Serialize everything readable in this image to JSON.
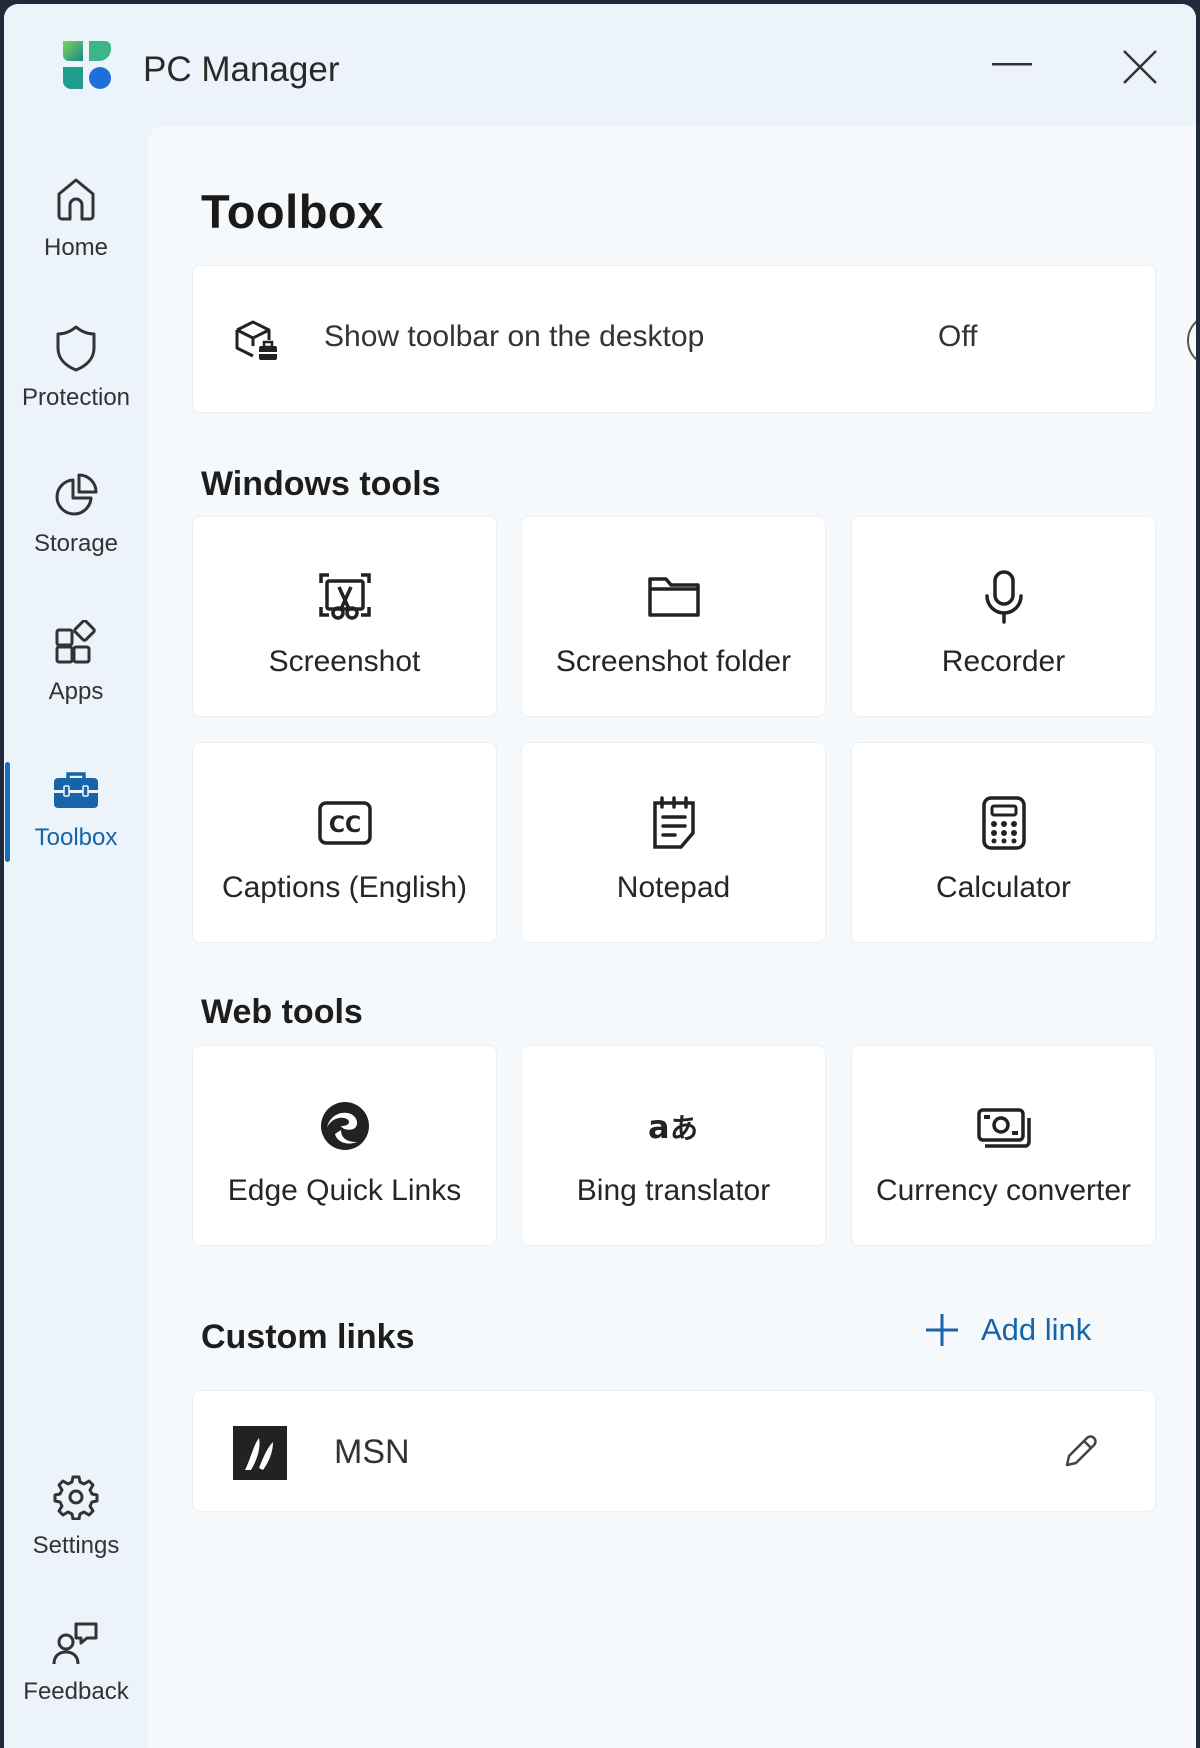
{
  "app": {
    "title": "PC Manager"
  },
  "sidebar": {
    "items": [
      {
        "label": "Home",
        "icon": "home-icon"
      },
      {
        "label": "Protection",
        "icon": "shield-icon"
      },
      {
        "label": "Storage",
        "icon": "pie-chart-icon"
      },
      {
        "label": "Apps",
        "icon": "apps-icon"
      },
      {
        "label": "Toolbox",
        "icon": "toolbox-icon",
        "active": true
      },
      {
        "label": "Settings",
        "icon": "gear-icon"
      },
      {
        "label": "Feedback",
        "icon": "feedback-icon"
      }
    ]
  },
  "page": {
    "title": "Toolbox"
  },
  "toolbar_setting": {
    "label": "Show toolbar on the desktop",
    "state": "Off",
    "enabled": false
  },
  "windows_tools": {
    "heading": "Windows tools",
    "items": [
      {
        "label": "Screenshot",
        "icon": "screenshot-icon"
      },
      {
        "label": "Screenshot folder",
        "icon": "folder-icon"
      },
      {
        "label": "Recorder",
        "icon": "microphone-icon"
      },
      {
        "label": "Captions (English)",
        "icon": "captions-icon"
      },
      {
        "label": "Notepad",
        "icon": "notepad-icon"
      },
      {
        "label": "Calculator",
        "icon": "calculator-icon"
      }
    ]
  },
  "web_tools": {
    "heading": "Web tools",
    "items": [
      {
        "label": "Edge Quick Links",
        "icon": "edge-icon"
      },
      {
        "label": "Bing translator",
        "icon": "translate-icon"
      },
      {
        "label": "Currency converter",
        "icon": "currency-icon"
      }
    ]
  },
  "custom_links": {
    "heading": "Custom links",
    "add_label": "Add link",
    "items": [
      {
        "label": "MSN"
      }
    ]
  },
  "colors": {
    "accent": "#1565a8",
    "background": "#ecf3fa",
    "card": "#ffffff"
  }
}
